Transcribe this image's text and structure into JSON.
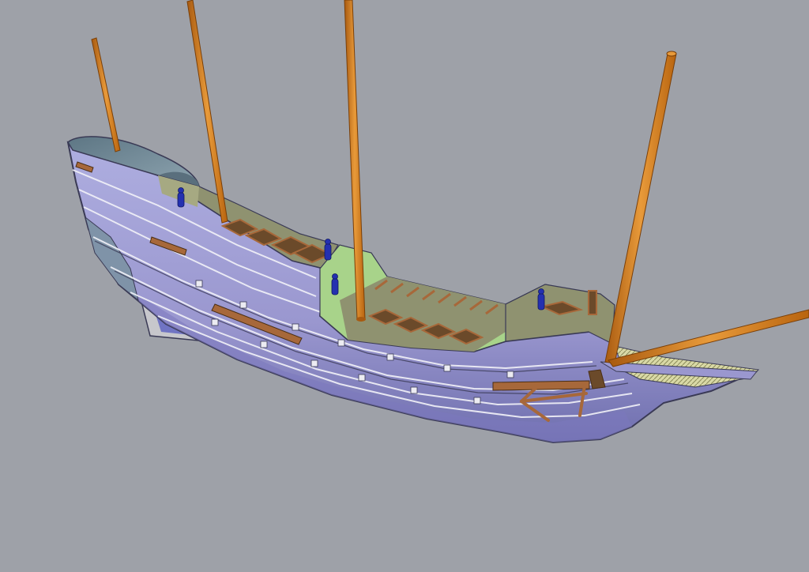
{
  "scene": {
    "subject": "ship-hull-3d-model",
    "background_color": "#9ea1a8",
    "colors": {
      "hull": "#9a97cf",
      "hull_dark": "#6f6fae",
      "hull_edge": "#3a3a55",
      "plank_line": "#f2f2f8",
      "deck": "#8f9270",
      "deck_light": "#b6c7a0",
      "bulkhead": "#a8d38a",
      "mast": "#c9741a",
      "mast_highlight": "#e89a3a",
      "wood": "#6b4a2a",
      "wood_light": "#a7683a",
      "figure": "#2430b0",
      "canopy": "#6f8795",
      "keel": "#c7c7cc",
      "grating": "#d9d9a6"
    },
    "mast_count": 5,
    "figure_count": 4
  }
}
